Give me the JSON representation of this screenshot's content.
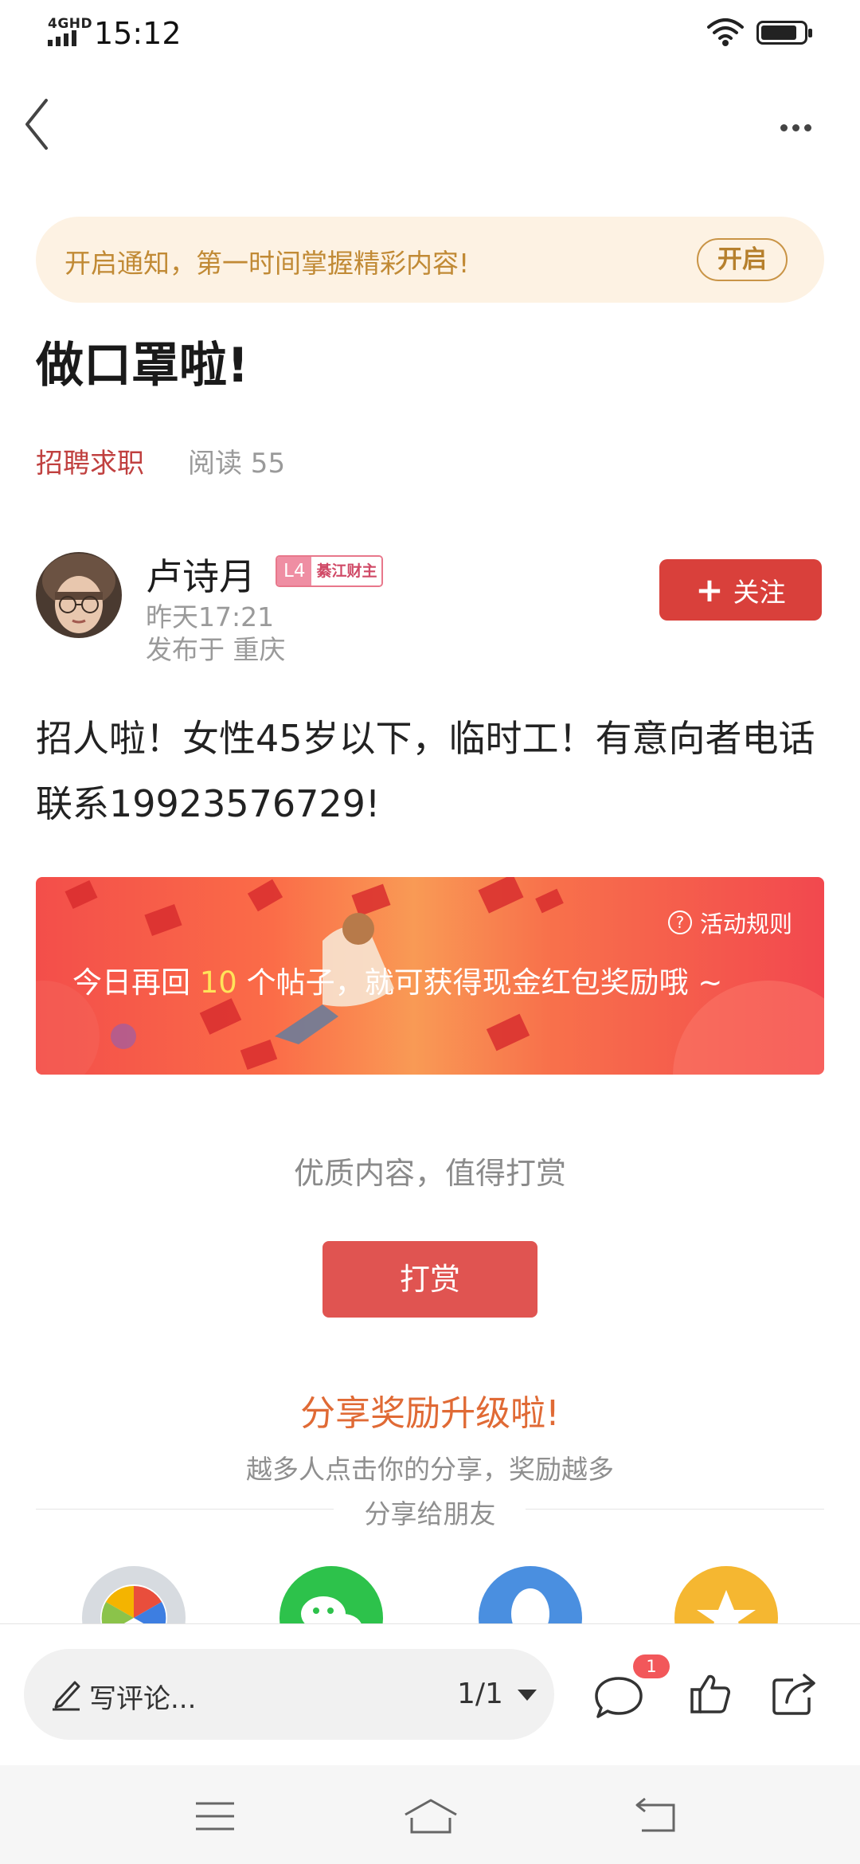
{
  "status_bar": {
    "network": "4GHD",
    "time": "15:12"
  },
  "notification": {
    "text": "开启通知，第一时间掌握精彩内容!",
    "button": "开启"
  },
  "post": {
    "title": "做口罩啦!",
    "category": "招聘求职",
    "reads": "阅读 55",
    "content": "招人啦！女性45岁以下，临时工！有意向者电话联系19923576729!"
  },
  "author": {
    "name": "卢诗月",
    "level": "L4",
    "level_title": "綦江财主",
    "time": "昨天17:21",
    "location": "发布于 重庆",
    "follow_label": "关注"
  },
  "banner": {
    "rules": "活动规则",
    "text_before": "今日再回 ",
    "highlight": "10",
    "text_after": " 个帖子，就可获得现金红包奖励哦 ~"
  },
  "reward": {
    "hint": "优质内容，值得打赏",
    "button": "打赏"
  },
  "share": {
    "title": "分享奖励升级啦!",
    "subtitle": "越多人点击你的分享，奖励越多",
    "friends": "分享给朋友"
  },
  "bottom_bar": {
    "comment_placeholder": "写评论...",
    "page_indicator": "1/1",
    "comment_badge": "1"
  },
  "colors": {
    "accent": "#d9403b",
    "notify_bg": "#fdf2e3",
    "share_title": "#e06a35"
  }
}
